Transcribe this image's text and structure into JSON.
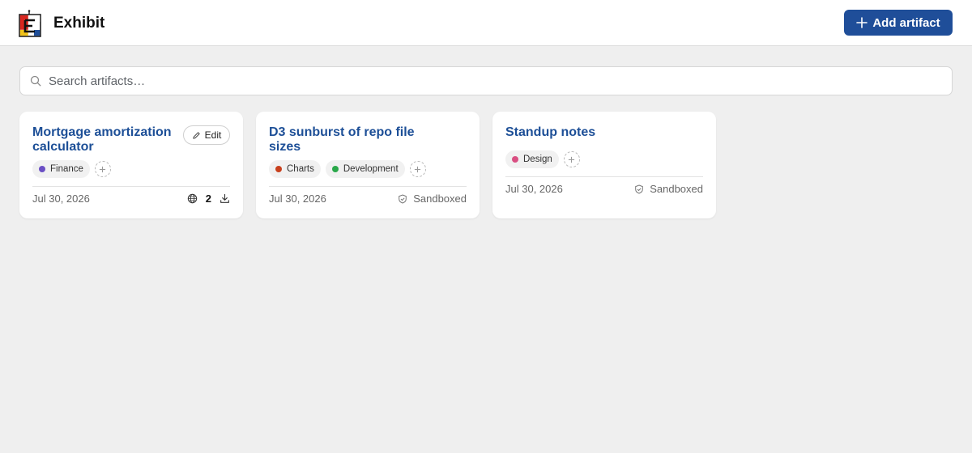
{
  "header": {
    "app_title": "Exhibit",
    "add_button_label": "Add artifact"
  },
  "search": {
    "placeholder": "Search artifacts…",
    "value": ""
  },
  "cards": [
    {
      "title": "Mortgage amortization calculator",
      "edit_label": "Edit",
      "tags": [
        {
          "label": "Finance",
          "color": "#6a4fc4"
        }
      ],
      "date": "Jul 30, 2026",
      "share_count": "2"
    },
    {
      "title": "D3 sunburst of repo file sizes",
      "tags": [
        {
          "label": "Charts",
          "color": "#c8401d"
        },
        {
          "label": "Development",
          "color": "#2aa84a"
        }
      ],
      "date": "Jul 30, 2026",
      "status": "Sandboxed"
    },
    {
      "title": "Standup notes",
      "tags": [
        {
          "label": "Design",
          "color": "#d94f82"
        }
      ],
      "date": "Jul 30, 2026",
      "status": "Sandboxed"
    }
  ],
  "colors": {
    "accent": "#1f4e99",
    "title_link": "#1d4f97",
    "background": "#efefef"
  }
}
